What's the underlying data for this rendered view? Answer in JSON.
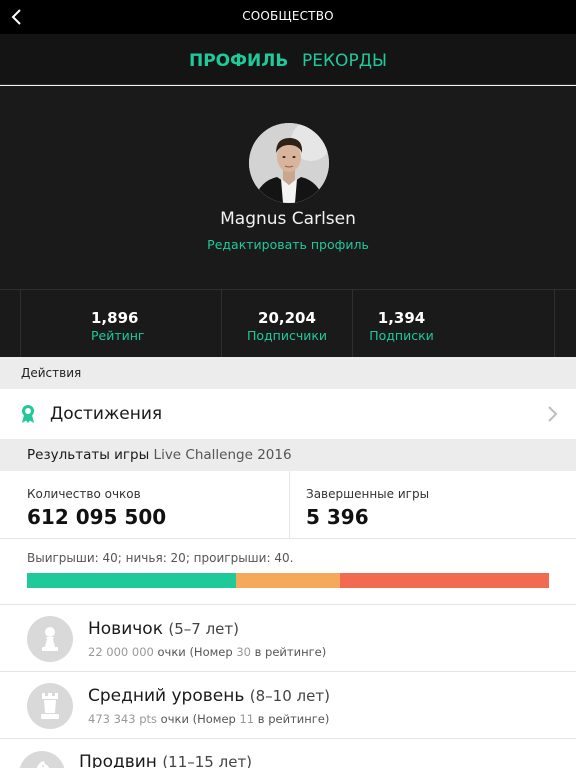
{
  "header": {
    "title": "СООБЩЕСТВО",
    "back_icon": "chevron-left-icon"
  },
  "tabs": [
    {
      "label": "ПРОФИЛЬ",
      "active": true
    },
    {
      "label": "РЕКОРДЫ",
      "active": false
    }
  ],
  "profile": {
    "name": "Magnus Carlsen",
    "edit_label": "Редактировать профиль",
    "avatar_icon": "avatar-photo"
  },
  "stats": [
    {
      "value": "1,896",
      "label": "Рейтинг"
    },
    {
      "value": "20,204",
      "label": "Подписчики"
    },
    {
      "value": "1,394",
      "label": "Подписки"
    }
  ],
  "actions": {
    "section_label": "Действия",
    "achievements_label": "Достижения",
    "achievements_icon": "ribbon-icon"
  },
  "results": {
    "title": "Результаты игры",
    "subtitle": "Live Challenge 2016",
    "points_label": "Количество очков",
    "points_value": "612 095 500",
    "games_label": "Завершенные игры",
    "games_value": "5 396",
    "wdl_text": "Выигрыши: 40; ничья: 20; проигрыши: 40.",
    "wdl": {
      "wins": 40,
      "draws": 20,
      "losses": 40
    }
  },
  "levels": [
    {
      "name": "Новичок",
      "age": "(5–7 лет)",
      "points_value": "22 000 000",
      "points_unit": "очки",
      "rank_prefix": "(Номер",
      "rank": "30",
      "rank_suffix": "в рейтинге)",
      "icon": "pawn-icon"
    },
    {
      "name": "Средний уровень",
      "age": "(8–10 лет)",
      "points_value": "473 343 pts",
      "points_unit": "очки",
      "rank_prefix": "(Номер",
      "rank": "11",
      "rank_suffix": "в рейтинге)",
      "icon": "rook-icon"
    },
    {
      "name": "Продвин",
      "age": "(11–15 лет)",
      "icon": "knight-icon"
    }
  ],
  "colors": {
    "accent": "#1fc99a",
    "wins": "#1fc99a",
    "draws": "#f5a95a",
    "losses": "#f26a4f",
    "header_bg": "#000000",
    "profile_bg": "#1a1a1a"
  }
}
